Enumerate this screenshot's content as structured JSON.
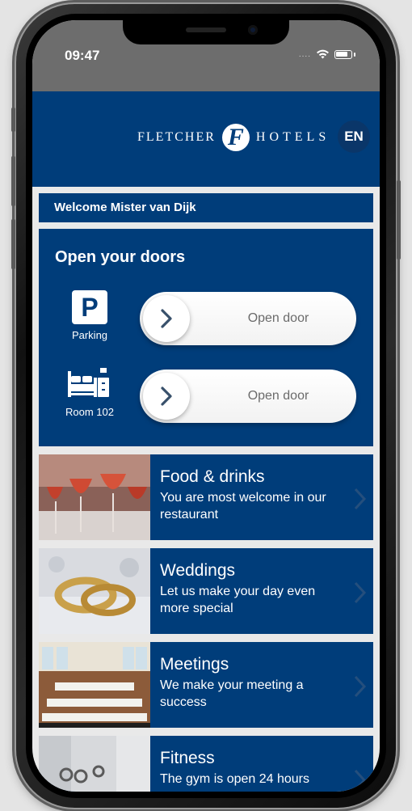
{
  "status_bar": {
    "time": "09:47",
    "signal": "....",
    "icons": [
      "wifi-icon",
      "battery-icon"
    ]
  },
  "header": {
    "brand_left": "FLETCHER",
    "brand_right": "HOTELS",
    "brand_mark": "F",
    "language": "EN"
  },
  "welcome": {
    "text": "Welcome Mister van Dijk"
  },
  "doors": {
    "title": "Open your doors",
    "items": [
      {
        "icon": "parking-icon",
        "glyph": "P",
        "label": "Parking",
        "action": "Open door"
      },
      {
        "icon": "bed-icon",
        "label": "Room 102",
        "action": "Open door"
      }
    ]
  },
  "cards": [
    {
      "title": "Food & drinks",
      "description": "You are most welcome in our restaurant",
      "image": "wine-glasses-photo"
    },
    {
      "title": "Weddings",
      "description": "Let us make your day even more special",
      "image": "wedding-rings-photo"
    },
    {
      "title": "Meetings",
      "description": "We make your meeting a success",
      "image": "meeting-room-photo"
    },
    {
      "title": "Fitness",
      "description": "The gym is open 24 hours",
      "image": "gym-photo"
    }
  ],
  "colors": {
    "brand_blue": "#003d7a",
    "status_bar": "#6d6d6d",
    "background": "#e9e9e9",
    "slider_text": "#6b6b6b"
  }
}
